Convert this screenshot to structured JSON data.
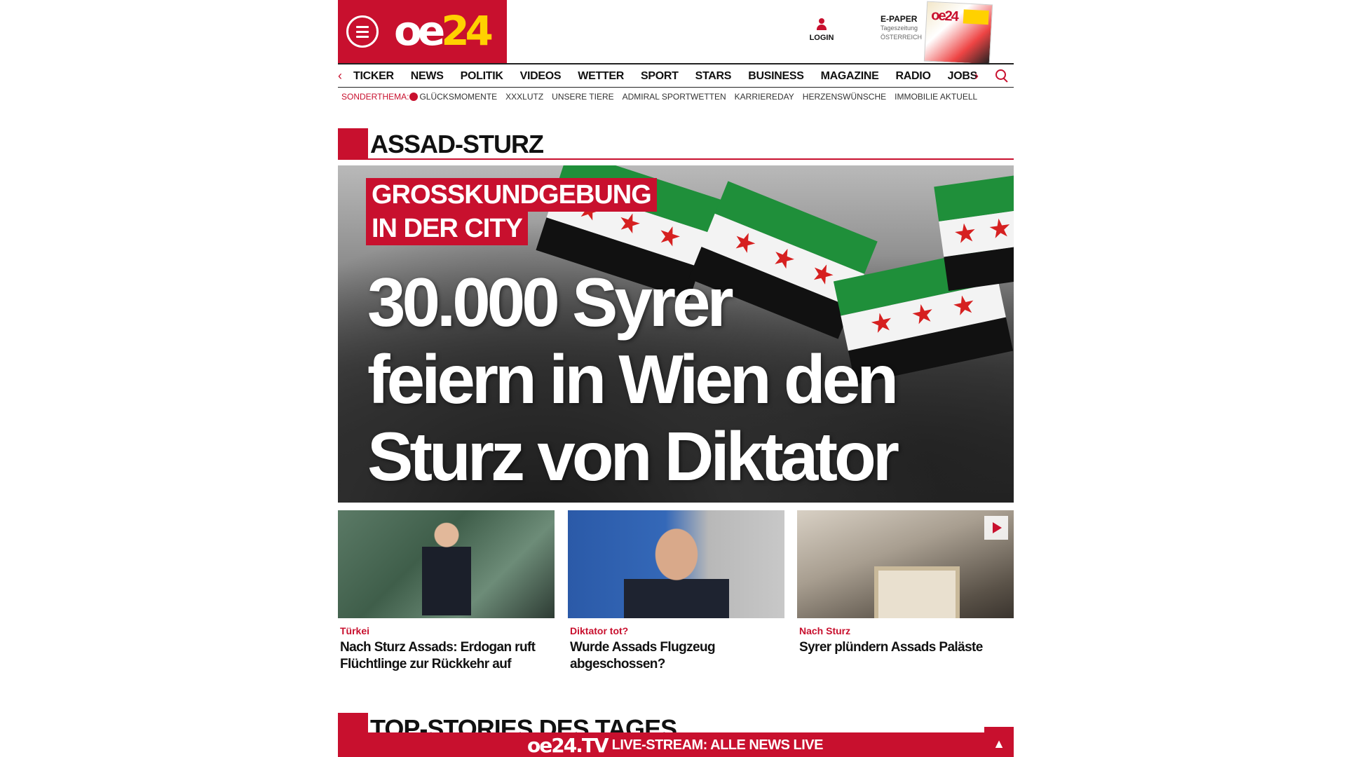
{
  "header": {
    "logo_oe": "oe",
    "logo_num": "24",
    "login_label": "LOGIN",
    "epaper_title": "E-PAPER",
    "epaper_sub1": "Tageszeitung",
    "epaper_sub2": "ÖSTERREICH"
  },
  "nav": {
    "items": [
      "TICKER",
      "NEWS",
      "POLITIK",
      "VIDEOS",
      "WETTER",
      "SPORT",
      "STARS",
      "BUSINESS",
      "MAGAZINE",
      "RADIO",
      "JOBS"
    ],
    "left_arrow": "‹",
    "right_arrow": "›"
  },
  "sub_nav": {
    "label": "SONDERTHEMA:",
    "items": [
      "GLÜCKSMOMENTE",
      "XXXLUTZ",
      "UNSERE TIERE",
      "ADMIRAL SPORTWETTEN",
      "KARRIEREDAY",
      "HERZENSWÜNSCHE",
      "IMMOBILIE AKTUELL"
    ]
  },
  "section": {
    "title": "ASSAD-STURZ"
  },
  "hero": {
    "kicker_line1": "GROSSKUNDGEBUNG",
    "kicker_line2": "IN DER CITY",
    "title_line1": "30.000 Syrer",
    "title_line2": "feiern in Wien den",
    "title_line3": "Sturz von Diktator Assad"
  },
  "teasers": [
    {
      "kicker": "Türkei",
      "title": "Nach Sturz Assads: Erdogan ruft Flüchtlinge zur Rückkehr auf"
    },
    {
      "kicker": "Diktator tot?",
      "title": "Wurde Assads Flugzeug abgeschossen?"
    },
    {
      "kicker": "Nach Sturz",
      "title": "Syrer plündern Assads Paläste"
    }
  ],
  "top_stories": {
    "title": "TOP-STORIES DES TAGES"
  },
  "live_bar": {
    "logo": "oe24.TV",
    "text": "LIVE-STREAM: ALLE NEWS LIVE",
    "up_arrow": "▲"
  },
  "colors": {
    "brand_red": "#c8102e",
    "logo_yellow": "#ffd100"
  }
}
